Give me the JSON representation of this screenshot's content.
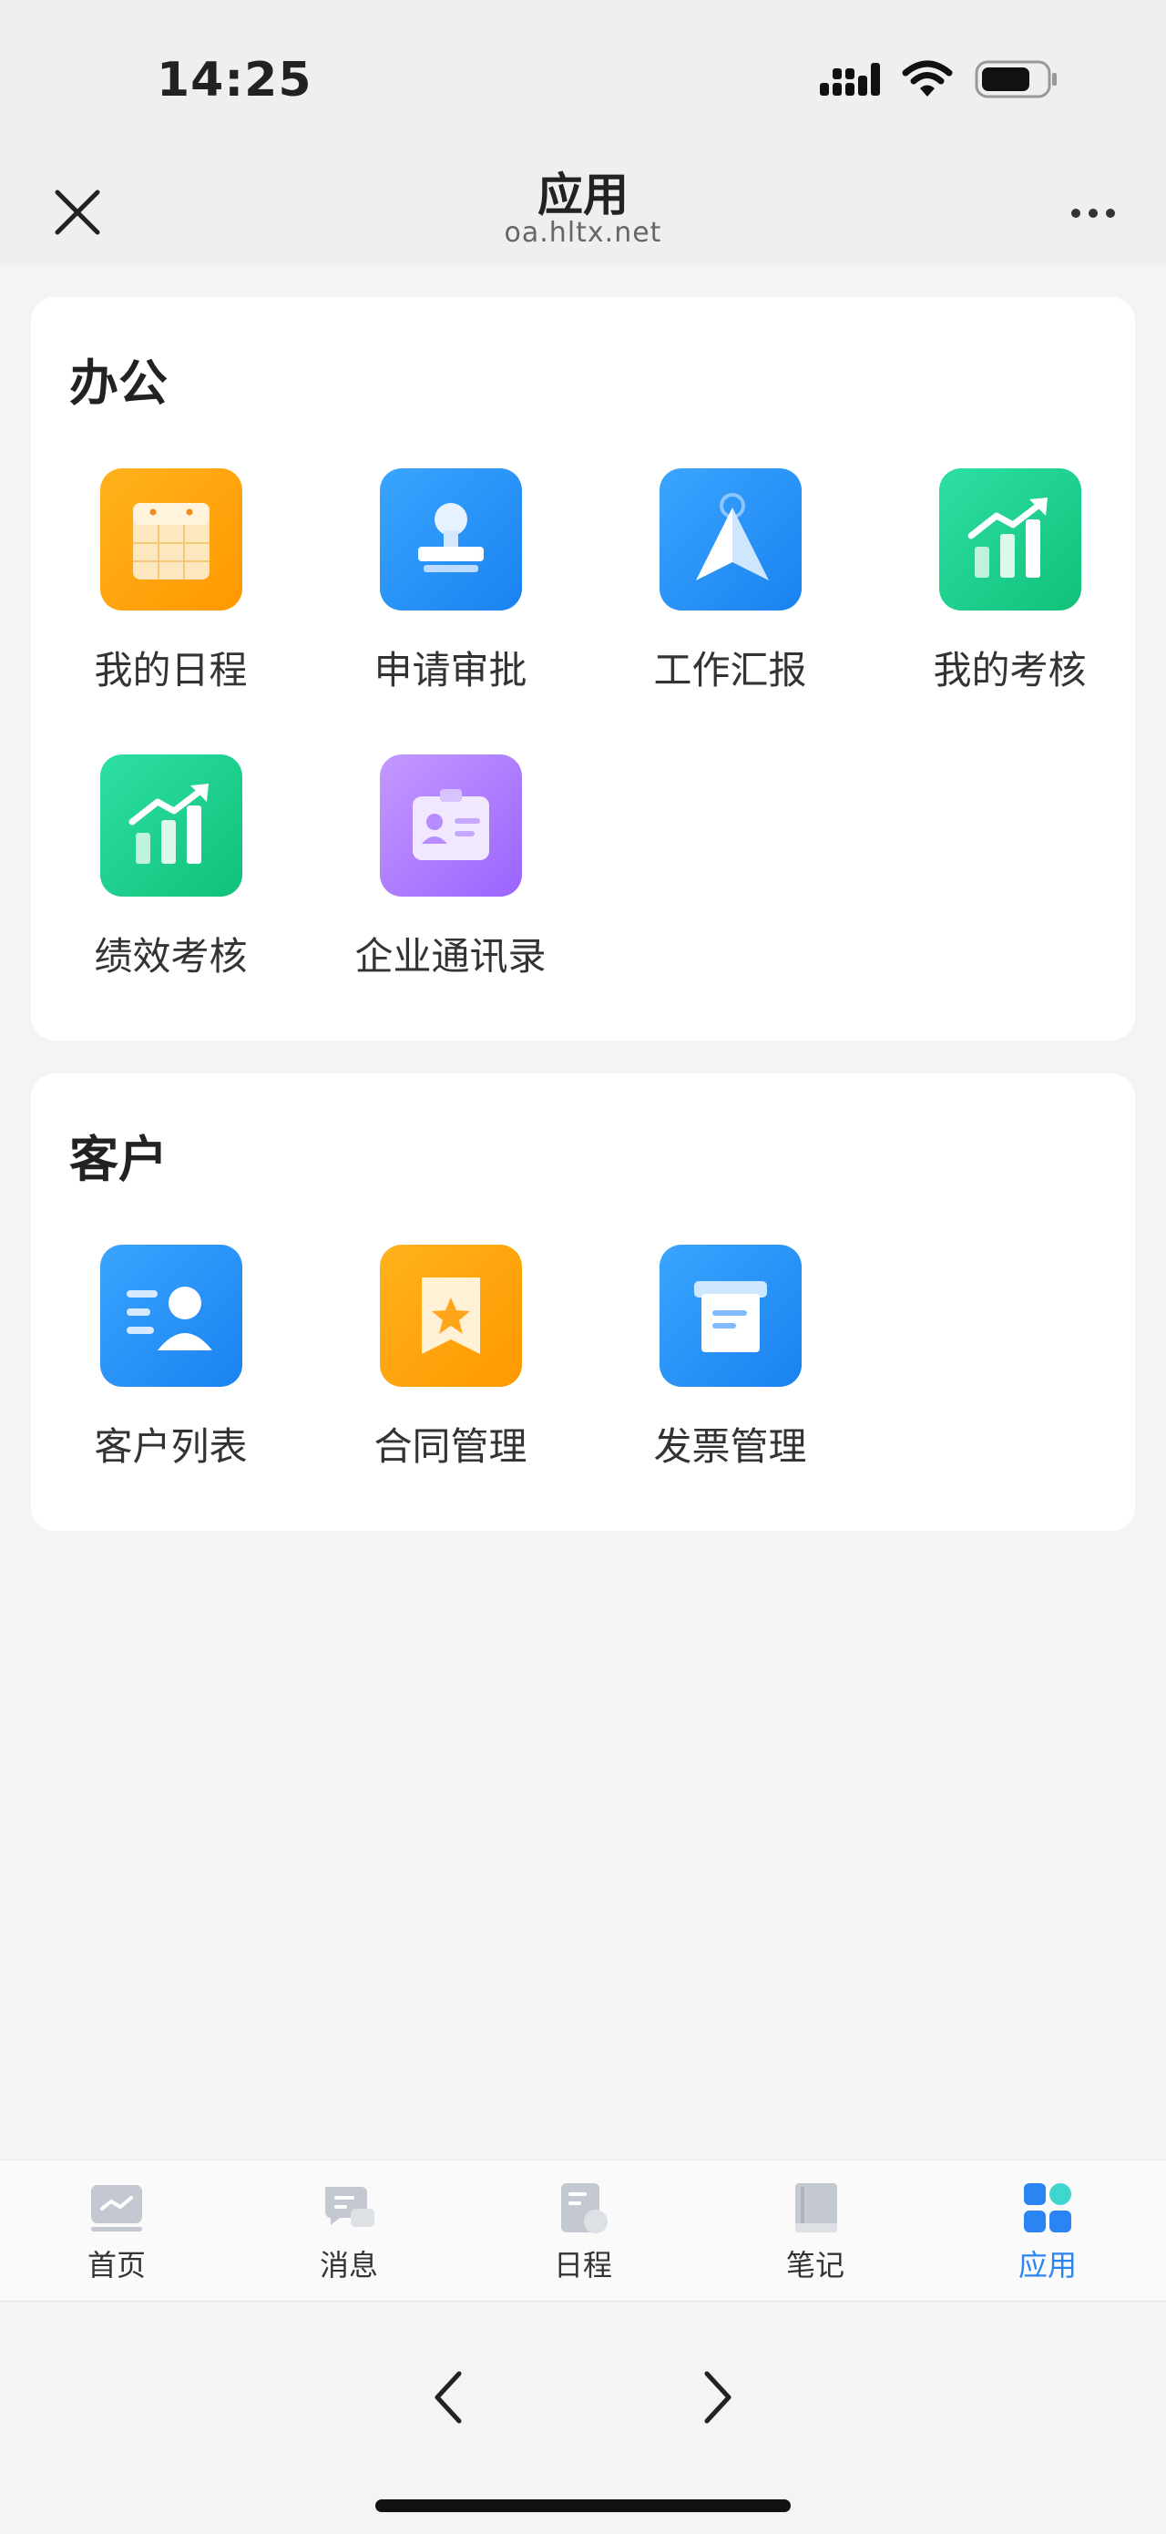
{
  "status": {
    "time": "14:25"
  },
  "header": {
    "title": "应用",
    "subtitle": "oa.hltx.net"
  },
  "sections": [
    {
      "title": "办公",
      "apps": [
        {
          "label": "我的日程",
          "icon": "calendar-icon"
        },
        {
          "label": "申请审批",
          "icon": "stamp-icon"
        },
        {
          "label": "工作汇报",
          "icon": "paper-plane-icon"
        },
        {
          "label": "我的考核",
          "icon": "growth-chart-icon"
        },
        {
          "label": "绩效考核",
          "icon": "growth-chart-icon"
        },
        {
          "label": "企业通讯录",
          "icon": "contact-card-icon"
        }
      ]
    },
    {
      "title": "客户",
      "apps": [
        {
          "label": "客户列表",
          "icon": "customer-list-icon"
        },
        {
          "label": "合同管理",
          "icon": "contract-star-icon"
        },
        {
          "label": "发票管理",
          "icon": "invoice-icon"
        }
      ]
    }
  ],
  "tabbar": [
    {
      "label": "首页",
      "icon": "home-chart-icon",
      "active": false
    },
    {
      "label": "消息",
      "icon": "message-icon",
      "active": false
    },
    {
      "label": "日程",
      "icon": "schedule-icon",
      "active": false
    },
    {
      "label": "笔记",
      "icon": "notebook-icon",
      "active": false
    },
    {
      "label": "应用",
      "icon": "apps-grid-icon",
      "active": true
    }
  ],
  "colors": {
    "accent": "#2a84f4",
    "orange": "#ff9800",
    "blue": "#1a82f0",
    "green": "#11c07a",
    "purple": "#9a64ff"
  }
}
